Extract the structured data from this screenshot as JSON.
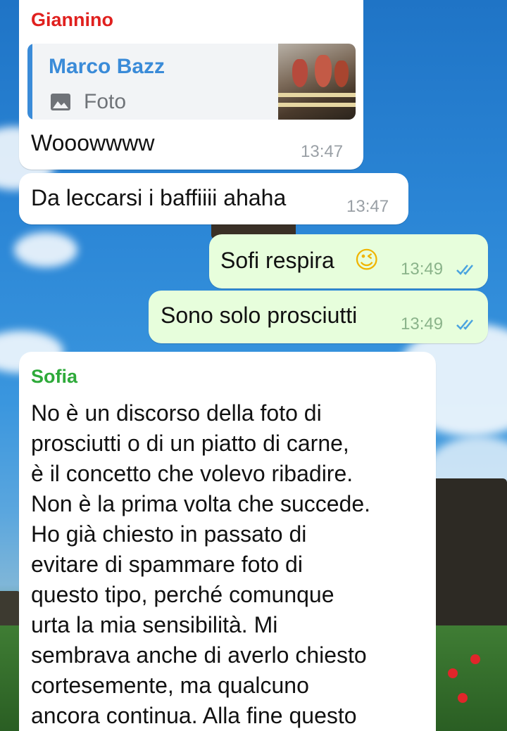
{
  "chat": {
    "messages": [
      {
        "sender": "Giannino",
        "sender_color": "#e0201e",
        "reply": {
          "author": "Marco Bazz",
          "kind": "Foto"
        },
        "text": "Wooowwww",
        "time": "13:47"
      },
      {
        "text": "Da leccarsi i baffiiii ahaha",
        "time": "13:47"
      },
      {
        "outgoing": true,
        "text": "Sofi respira",
        "emoji": "😉",
        "time": "13:49",
        "status": "read"
      },
      {
        "outgoing": true,
        "text": "Sono solo prosciutti",
        "time": "13:49",
        "status": "read"
      },
      {
        "sender": "Sofia",
        "sender_color": "#2eaa3a",
        "lines": [
          "No è un discorso della foto di",
          "prosciutti o di un piatto di carne,",
          "è il concetto che volevo ribadire.",
          "Non è la prima volta che succede.",
          "Ho già chiesto in passato di",
          "evitare di spammare foto di",
          "questo tipo, perché comunque",
          "urta la mia sensibilità. Mi",
          "sembrava anche di averlo chiesto",
          "cortesemente, ma qualcuno",
          "ancora continua. Alla fine questo"
        ]
      }
    ]
  },
  "colors": {
    "incoming_bubble": "#ffffff",
    "outgoing_bubble": "#e7fedc",
    "read_ticks": "#4aa3df",
    "link_author": "#3a8bd8"
  },
  "icons": [
    "image-icon",
    "double-check-icon"
  ]
}
